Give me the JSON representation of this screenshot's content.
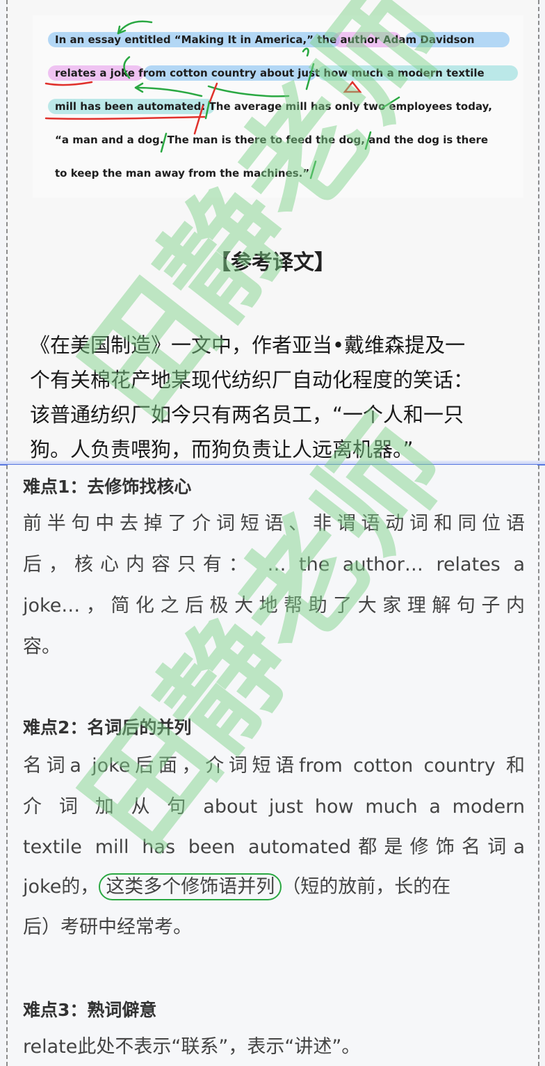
{
  "essay": {
    "lines": [
      "In an essay entitled “Making It in America,” the author Adam Davidson",
      "relates a joke from cotton country about just how much a modern textile",
      "mill has been automated: The average mill has only two employees today,",
      "“a man and a dog. The man is there to feed the dog, and the dog is there",
      "to keep the man away from the machines.”"
    ]
  },
  "reference": {
    "title": "【参考译文】",
    "lines": [
      "《在美国制造》一文中，作者亚当•戴维森提及一",
      "个有关棉花产地某现代纺织厂自动化程度的笑话：",
      "该普通纺织厂如今只有两名员工，“一个人和一只",
      "狗。人负责喂狗，而狗负责让人远离机器。”"
    ]
  },
  "notes": [
    {
      "heading": "难点1：去修饰找核心",
      "lines": [
        "前半句中去掉了介词短语、非谓语动词和同位语",
        "后，核心内容只有： … the author… relates a",
        "joke…，简化之后极大地帮助了大家理解句子内",
        "容。"
      ]
    },
    {
      "heading": "难点2：名词后的并列",
      "lines": [
        "名词a joke后面，介词短语from cotton country 和",
        "介 词 加 从 句 about just how much a modern",
        "textile mill has been automated都是修饰名词a",
        "后）考研中经常考。"
      ],
      "line4_pre": "joke的，",
      "line4_circled": "这类多个修饰语并列",
      "line4_post": "（短的放前，长的在"
    },
    {
      "heading": "难点3：熟词僻意",
      "lines": [
        "relate此处不表示“联系”，表示“讲述”。"
      ]
    }
  ],
  "watermark": {
    "text": "田静老师",
    "color": "#7fd38a"
  },
  "colors": {
    "annotation_green": "#2aa842",
    "annotation_red": "#e0312b",
    "highlight_blue": "#78b9f0",
    "highlight_pink": "#e696eb",
    "highlight_teal": "#6ed2d2"
  }
}
